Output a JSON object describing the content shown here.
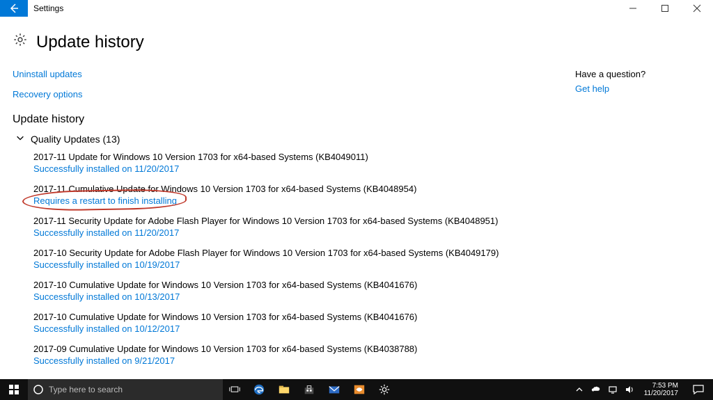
{
  "window": {
    "app_title": "Settings"
  },
  "page": {
    "title": "Update history",
    "uninstall_link": "Uninstall updates",
    "recovery_link": "Recovery options",
    "section_heading": "Update history",
    "group_label": "Quality Updates (13)"
  },
  "aside": {
    "heading": "Have a question?",
    "get_help": "Get help"
  },
  "updates": [
    {
      "title": "2017-11 Update for Windows 10 Version 1703 for x64-based Systems (KB4049011)",
      "status": "Successfully installed on 11/20/2017",
      "circled": false
    },
    {
      "title": "2017-11 Cumulative Update for Windows 10 Version 1703 for x64-based Systems (KB4048954)",
      "status": "Requires a restart to finish installing",
      "circled": true
    },
    {
      "title": "2017-11 Security Update for Adobe Flash Player for Windows 10 Version 1703 for x64-based Systems (KB4048951)",
      "status": "Successfully installed on 11/20/2017",
      "circled": false
    },
    {
      "title": "2017-10 Security Update for Adobe Flash Player for Windows 10 Version 1703 for x64-based Systems (KB4049179)",
      "status": "Successfully installed on 10/19/2017",
      "circled": false
    },
    {
      "title": "2017-10 Cumulative Update for Windows 10 Version 1703 for x64-based Systems (KB4041676)",
      "status": "Successfully installed on 10/13/2017",
      "circled": false
    },
    {
      "title": "2017-10 Cumulative Update for Windows 10 Version 1703 for x64-based Systems (KB4041676)",
      "status": "Successfully installed on 10/12/2017",
      "circled": false
    },
    {
      "title": "2017-09 Cumulative Update for Windows 10 Version 1703 for x64-based Systems (KB4038788)",
      "status": "Successfully installed on 9/21/2017",
      "circled": false
    }
  ],
  "taskbar": {
    "search_placeholder": "Type here to search",
    "time": "7:53 PM",
    "date": "11/20/2017"
  }
}
